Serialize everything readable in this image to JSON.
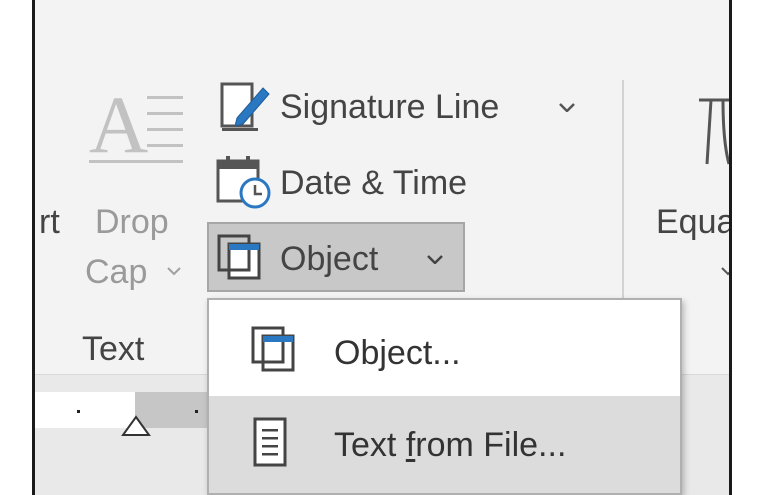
{
  "ribbon": {
    "text_group_label": "Text",
    "partial_left_label": "rt",
    "drop_cap": {
      "line1": "Drop",
      "line2": "Cap"
    },
    "signature_line_label": "Signature Line",
    "date_time_label": "Date & Time",
    "object_label": "Object",
    "equation_label": "Equa"
  },
  "object_menu": {
    "items": [
      {
        "label": "Object...",
        "icon": "object-icon"
      },
      {
        "label_pre": "Text ",
        "label_underlined": "f",
        "label_post": "rom File...",
        "icon": "text-file-icon"
      }
    ]
  }
}
